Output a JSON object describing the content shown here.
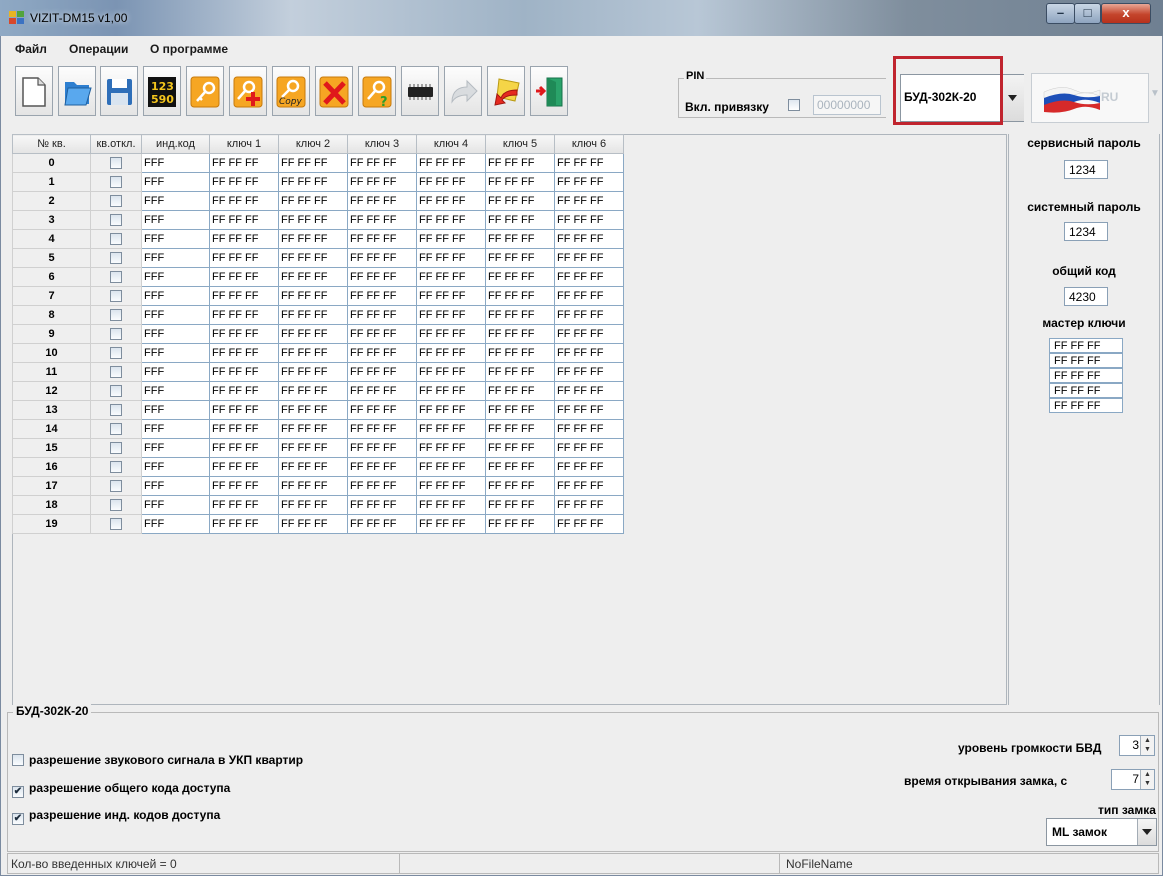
{
  "window": {
    "title": "VIZIT-DM15 v1,00",
    "minimize": "–",
    "maximize": "□",
    "close": "x"
  },
  "menu": [
    "Файл",
    "Операции",
    "О программе"
  ],
  "toolbar": {
    "icons": [
      "new-file-icon",
      "open-folder-icon",
      "save-icon",
      "numbers-keypad-icon",
      "key-icon",
      "add-key-icon",
      "copy-key-icon",
      "delete-key-icon",
      "key-question-icon",
      "chip-icon",
      "forward-arrow-icon",
      "import-arrow-icon",
      "exit-door-icon"
    ],
    "copy_text": "Copy"
  },
  "pin": {
    "title": "PIN",
    "binding_label": "Вкл. привязку",
    "value": "00000000",
    "binding_checked": false
  },
  "device_model": "БУД-302К-20",
  "language": {
    "code": "RU",
    "flag": "russian-flag-icon"
  },
  "table": {
    "headers": [
      "№ кв.",
      "кв.откл.",
      "инд.код",
      "ключ 1",
      "ключ 2",
      "ключ 3",
      "ключ 4",
      "ключ 5",
      "ключ 6"
    ],
    "rows": [
      {
        "n": "0",
        "code": "FFF",
        "keys": [
          "FF FF FF",
          "FF FF FF",
          "FF FF FF",
          "FF FF FF",
          "FF FF FF",
          "FF FF FF"
        ]
      },
      {
        "n": "1",
        "code": "FFF",
        "keys": [
          "FF FF FF",
          "FF FF FF",
          "FF FF FF",
          "FF FF FF",
          "FF FF FF",
          "FF FF FF"
        ]
      },
      {
        "n": "2",
        "code": "FFF",
        "keys": [
          "FF FF FF",
          "FF FF FF",
          "FF FF FF",
          "FF FF FF",
          "FF FF FF",
          "FF FF FF"
        ]
      },
      {
        "n": "3",
        "code": "FFF",
        "keys": [
          "FF FF FF",
          "FF FF FF",
          "FF FF FF",
          "FF FF FF",
          "FF FF FF",
          "FF FF FF"
        ]
      },
      {
        "n": "4",
        "code": "FFF",
        "keys": [
          "FF FF FF",
          "FF FF FF",
          "FF FF FF",
          "FF FF FF",
          "FF FF FF",
          "FF FF FF"
        ]
      },
      {
        "n": "5",
        "code": "FFF",
        "keys": [
          "FF FF FF",
          "FF FF FF",
          "FF FF FF",
          "FF FF FF",
          "FF FF FF",
          "FF FF FF"
        ]
      },
      {
        "n": "6",
        "code": "FFF",
        "keys": [
          "FF FF FF",
          "FF FF FF",
          "FF FF FF",
          "FF FF FF",
          "FF FF FF",
          "FF FF FF"
        ]
      },
      {
        "n": "7",
        "code": "FFF",
        "keys": [
          "FF FF FF",
          "FF FF FF",
          "FF FF FF",
          "FF FF FF",
          "FF FF FF",
          "FF FF FF"
        ]
      },
      {
        "n": "8",
        "code": "FFF",
        "keys": [
          "FF FF FF",
          "FF FF FF",
          "FF FF FF",
          "FF FF FF",
          "FF FF FF",
          "FF FF FF"
        ]
      },
      {
        "n": "9",
        "code": "FFF",
        "keys": [
          "FF FF FF",
          "FF FF FF",
          "FF FF FF",
          "FF FF FF",
          "FF FF FF",
          "FF FF FF"
        ]
      },
      {
        "n": "10",
        "code": "FFF",
        "keys": [
          "FF FF FF",
          "FF FF FF",
          "FF FF FF",
          "FF FF FF",
          "FF FF FF",
          "FF FF FF"
        ]
      },
      {
        "n": "11",
        "code": "FFF",
        "keys": [
          "FF FF FF",
          "FF FF FF",
          "FF FF FF",
          "FF FF FF",
          "FF FF FF",
          "FF FF FF"
        ]
      },
      {
        "n": "12",
        "code": "FFF",
        "keys": [
          "FF FF FF",
          "FF FF FF",
          "FF FF FF",
          "FF FF FF",
          "FF FF FF",
          "FF FF FF"
        ]
      },
      {
        "n": "13",
        "code": "FFF",
        "keys": [
          "FF FF FF",
          "FF FF FF",
          "FF FF FF",
          "FF FF FF",
          "FF FF FF",
          "FF FF FF"
        ]
      },
      {
        "n": "14",
        "code": "FFF",
        "keys": [
          "FF FF FF",
          "FF FF FF",
          "FF FF FF",
          "FF FF FF",
          "FF FF FF",
          "FF FF FF"
        ]
      },
      {
        "n": "15",
        "code": "FFF",
        "keys": [
          "FF FF FF",
          "FF FF FF",
          "FF FF FF",
          "FF FF FF",
          "FF FF FF",
          "FF FF FF"
        ]
      },
      {
        "n": "16",
        "code": "FFF",
        "keys": [
          "FF FF FF",
          "FF FF FF",
          "FF FF FF",
          "FF FF FF",
          "FF FF FF",
          "FF FF FF"
        ]
      },
      {
        "n": "17",
        "code": "FFF",
        "keys": [
          "FF FF FF",
          "FF FF FF",
          "FF FF FF",
          "FF FF FF",
          "FF FF FF",
          "FF FF FF"
        ]
      },
      {
        "n": "18",
        "code": "FFF",
        "keys": [
          "FF FF FF",
          "FF FF FF",
          "FF FF FF",
          "FF FF FF",
          "FF FF FF",
          "FF FF FF"
        ]
      },
      {
        "n": "19",
        "code": "FFF",
        "keys": [
          "FF FF FF",
          "FF FF FF",
          "FF FF FF",
          "FF FF FF",
          "FF FF FF",
          "FF FF FF"
        ]
      }
    ]
  },
  "right_panel": {
    "service_password_label": "сервисный пароль",
    "service_password": "1234",
    "system_password_label": "системный пароль",
    "system_password": "1234",
    "common_code_label": "общий код",
    "common_code": "4230",
    "master_keys_label": "мастер ключи",
    "master_keys": [
      "FF FF FF",
      "FF FF FF",
      "FF FF FF",
      "FF FF FF",
      "FF FF FF"
    ]
  },
  "settings": {
    "group_title": "БУД-302К-20",
    "checkboxes": [
      {
        "label": "разрешение звукового сигнала в УКП квартир",
        "checked": false
      },
      {
        "label": "разрешение общего кода доступа",
        "checked": true
      },
      {
        "label": "разрешение инд. кодов доступа",
        "checked": true
      }
    ],
    "volume_label": "уровень громкости БВД",
    "volume": "3",
    "lock_time_label": "время открывания замка, с",
    "lock_time": "7",
    "lock_type_label": "тип замка",
    "lock_type": "ML замок"
  },
  "status": {
    "keys_count": "Кол-во введенных ключей = 0",
    "middle": "",
    "file": "NoFileName"
  },
  "colors": {
    "highlight": "#c0242e",
    "cell_border": "#8aa8c4",
    "title_close": "#c4452c"
  }
}
